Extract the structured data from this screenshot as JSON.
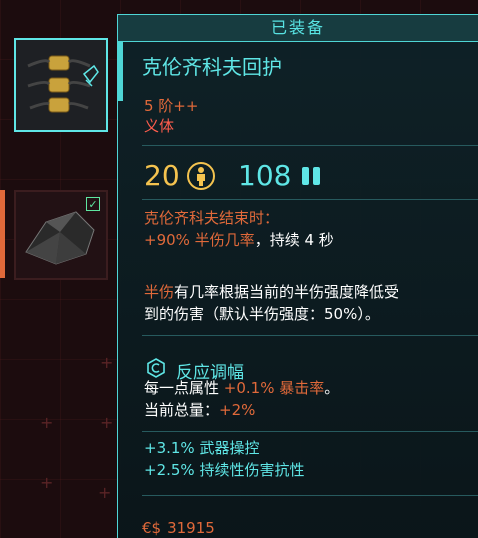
{
  "header": {
    "equipped_label": "已装备"
  },
  "slots": [
    {
      "id": "armadillo",
      "active": true
    },
    {
      "id": "other",
      "equipped": true
    }
  ],
  "item": {
    "name": "克伦齐科夫回护",
    "tier": "5 阶++",
    "category": "义体",
    "armor": "20",
    "cyberware_capacity": "108"
  },
  "effect": {
    "line1": "克伦齐科夫结束时：",
    "line2_prefix": "+90% 半伤几率",
    "line2_suffix": "，持续 4 秒",
    "desc_prefix": "半伤",
    "desc_line1": "有几率根据当前的半伤强度降低受",
    "desc_line2": "到的伤害（默认半伤强度：50%）。"
  },
  "modifier": {
    "title": "反应调幅",
    "line1_prefix": "每一点属性",
    "line1_value": "+0.1% 暴击率",
    "line1_suffix": "。",
    "line2_prefix": "当前总量：",
    "line2_value": "+2%"
  },
  "bonuses": [
    "+3.1% 武器操控",
    "+2.5% 持续性伤害抗性"
  ],
  "price": {
    "currency": "€$",
    "value": "31915"
  },
  "colors": {
    "cyan": "#5fe6e6",
    "orange": "#e0693a",
    "red": "#ff5d4d",
    "yellow": "#f4c34f"
  }
}
